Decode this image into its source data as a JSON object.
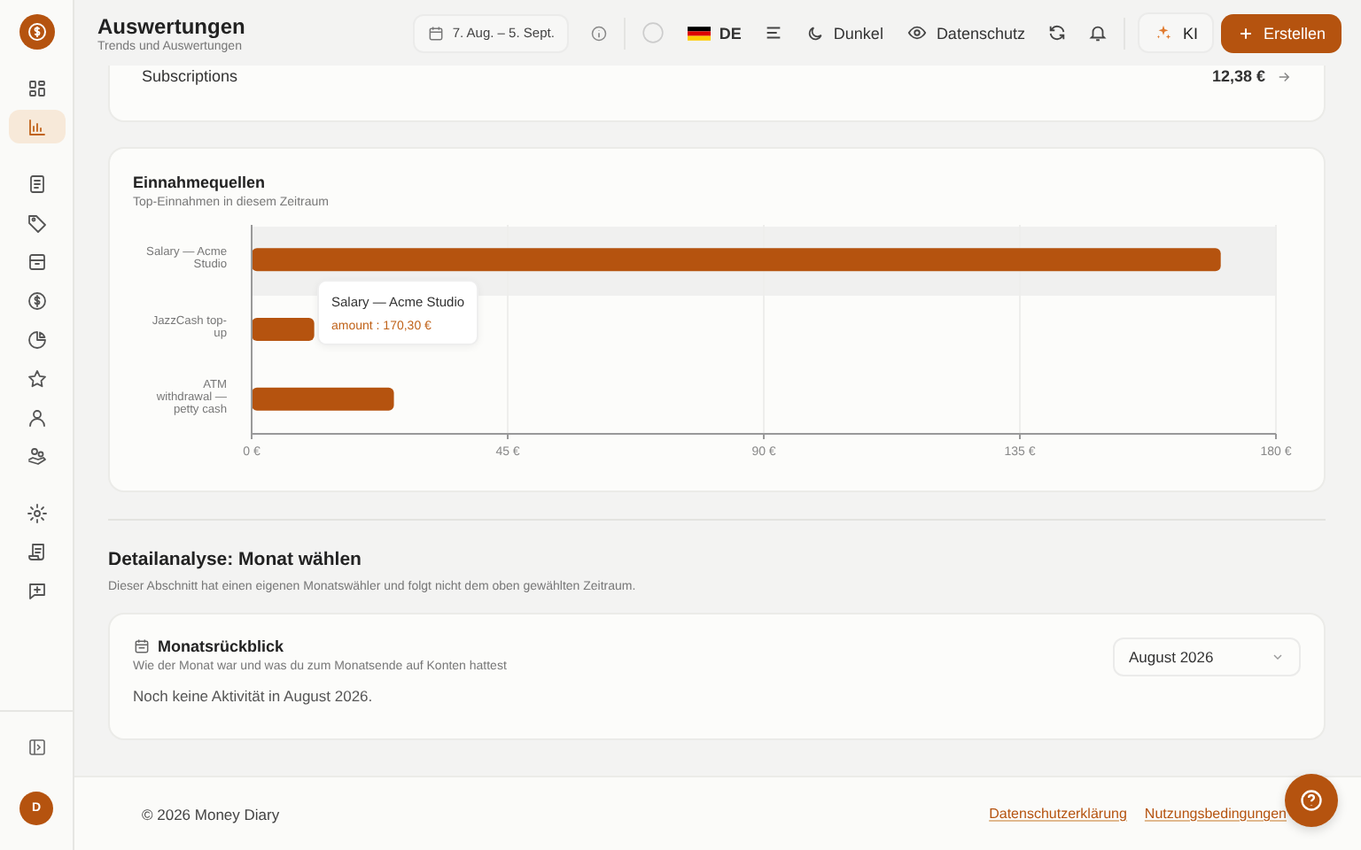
{
  "sidebar": {
    "items": [
      {
        "selected": false
      },
      {
        "selected": true
      },
      {
        "selected": false
      },
      {
        "selected": false
      },
      {
        "selected": false
      },
      {
        "selected": false
      },
      {
        "selected": false
      },
      {
        "selected": false
      },
      {
        "selected": false
      },
      {
        "selected": false
      },
      {
        "selected": false
      },
      {
        "selected": false
      },
      {
        "selected": false
      }
    ],
    "avatar": "D"
  },
  "header": {
    "title": "Auswertungen",
    "subtitle": "Trends und Auswertungen",
    "date_range": "7. Aug. – 5. Sept.",
    "language": "DE",
    "theme_button": "Dunkel",
    "privacy_button": "Datenschutz",
    "ai_button": "KI",
    "create_button": "Erstellen"
  },
  "summary_row": {
    "label": "Subscriptions",
    "amount": "12,38 €"
  },
  "income_card": {
    "title": "Einnahmequellen",
    "subtitle": "Top-Einnahmen in diesem Zeitraum",
    "chart_data": {
      "type": "bar",
      "orientation": "horizontal",
      "grid": true,
      "categories": [
        "Salary — Acme Studio",
        "JazzCash top-up",
        "ATM withdrawal — petty cash"
      ],
      "values": [
        170.3,
        11,
        25
      ],
      "xlim": [
        0,
        180
      ],
      "xticks": [
        {
          "value": 0,
          "label": "0 €"
        },
        {
          "value": 45,
          "label": "45 €"
        },
        {
          "value": 90,
          "label": "90 €"
        },
        {
          "value": 135,
          "label": "135 €"
        },
        {
          "value": 180,
          "label": "180 €"
        }
      ]
    },
    "tooltip": {
      "title": "Salary — Acme Studio",
      "text": "amount : 170,30 €"
    }
  },
  "detail_section": {
    "title": "Detailanalyse: Monat wählen",
    "description": "Dieser Abschnitt hat einen eigenen Monatswähler und folgt nicht dem oben gewählten Zeitraum."
  },
  "month_card": {
    "title": "Monatsrückblick",
    "subtitle": "Wie der Monat war und was du zum Monatsende auf Konten hattest",
    "month_select": "August 2026",
    "empty_message": "Noch keine Aktivität in August 2026."
  },
  "footer": {
    "copyright": "© 2026 Money Diary",
    "links": [
      "Datenschutzerklärung",
      "Nutzungsbedingungen"
    ]
  }
}
